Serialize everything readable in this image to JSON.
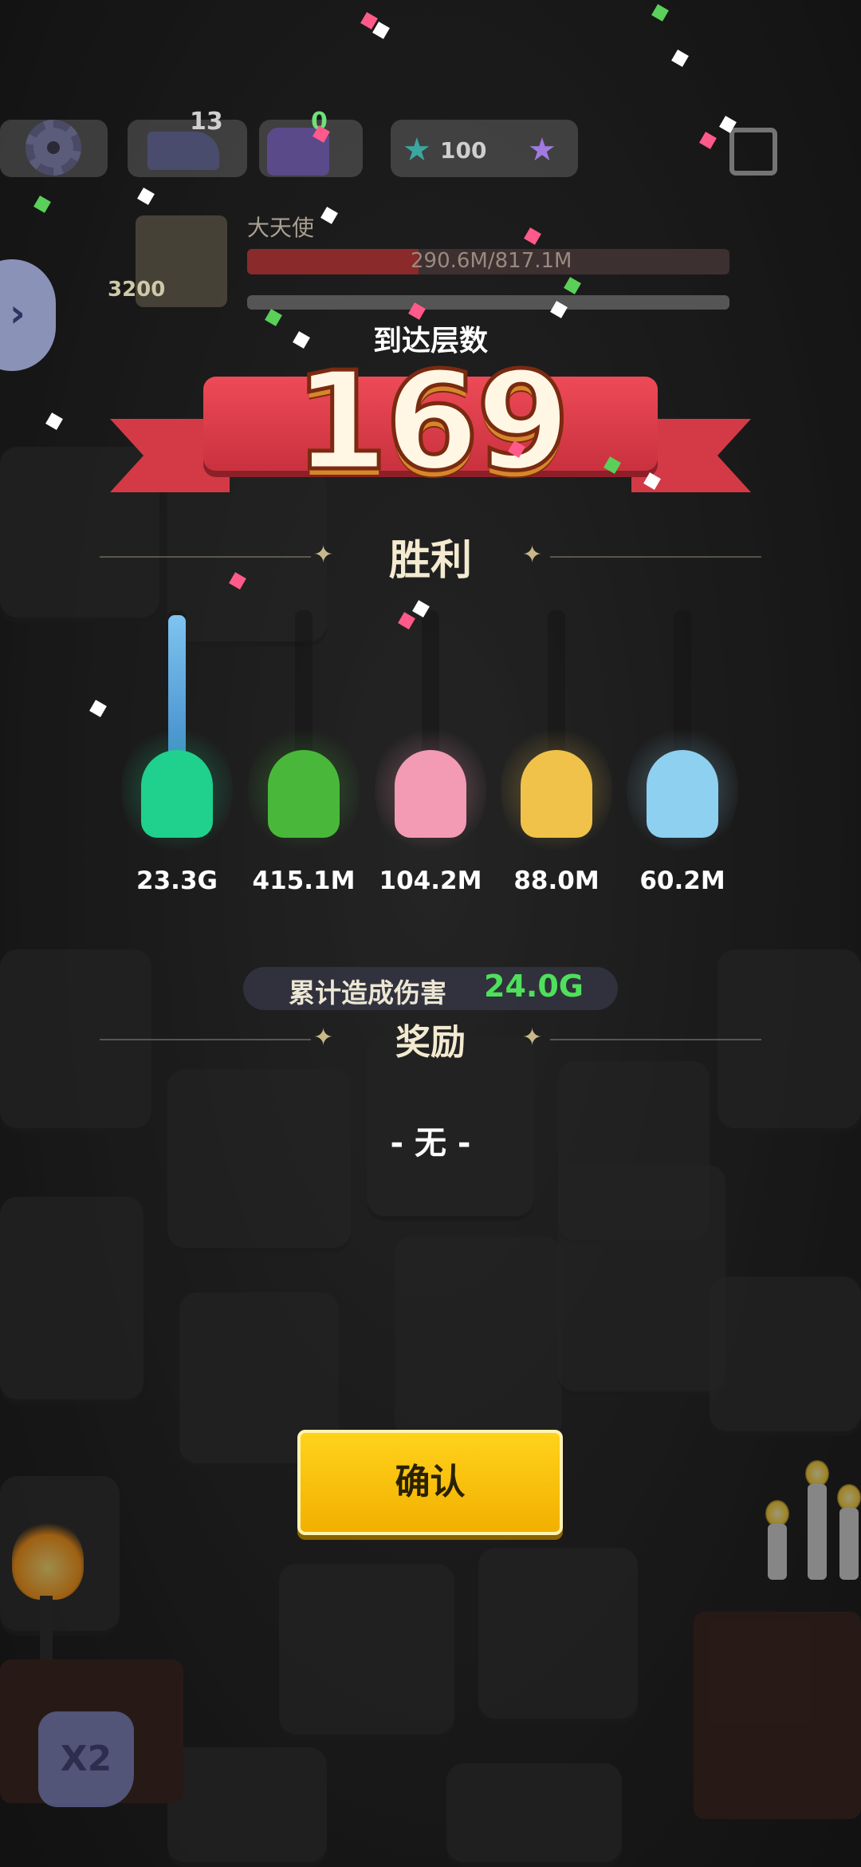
{
  "hud": {
    "anvil_count": "13",
    "chest_count": "0",
    "star_value": "100"
  },
  "boss": {
    "name": "大天使",
    "level": "3200",
    "hp_text": "290.6M/817.1M",
    "hp_fraction": 0.356
  },
  "result": {
    "floor_label": "到达层数",
    "floor_number": "169",
    "outcome": "胜利"
  },
  "heroes": [
    {
      "damage": "23.3G",
      "bar_fraction": 0.97,
      "color": "#1fd18c"
    },
    {
      "damage": "415.1M",
      "bar_fraction": 0.02,
      "color": "#49b83a"
    },
    {
      "damage": "104.2M",
      "bar_fraction": 0.01,
      "color": "#f39ab4"
    },
    {
      "damage": "88.0M",
      "bar_fraction": 0.0,
      "color": "#f0c24a"
    },
    {
      "damage": "60.2M",
      "bar_fraction": 0.0,
      "color": "#8ed0f0"
    }
  ],
  "total": {
    "label": "累计造成伤害",
    "value": "24.0G"
  },
  "reward": {
    "title": "奖励",
    "none_text": "- 无 -"
  },
  "buttons": {
    "confirm": "确认",
    "speed": "X2"
  }
}
